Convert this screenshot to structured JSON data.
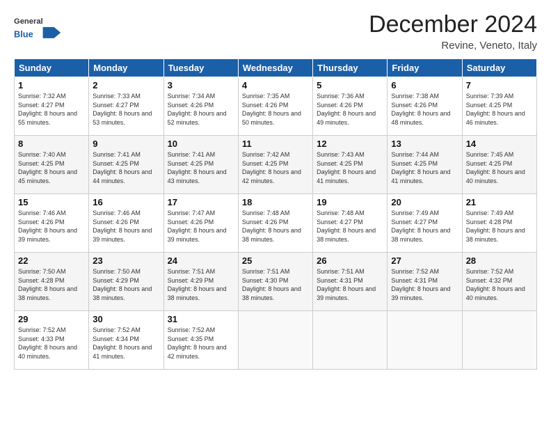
{
  "header": {
    "month": "December 2024",
    "location": "Revine, Veneto, Italy",
    "logo_general": "General",
    "logo_blue": "Blue"
  },
  "weekdays": [
    "Sunday",
    "Monday",
    "Tuesday",
    "Wednesday",
    "Thursday",
    "Friday",
    "Saturday"
  ],
  "weeks": [
    [
      {
        "day": 1,
        "sunrise": "7:32 AM",
        "sunset": "4:27 PM",
        "daylight": "8 hours and 55 minutes."
      },
      {
        "day": 2,
        "sunrise": "7:33 AM",
        "sunset": "4:27 PM",
        "daylight": "8 hours and 53 minutes."
      },
      {
        "day": 3,
        "sunrise": "7:34 AM",
        "sunset": "4:26 PM",
        "daylight": "8 hours and 52 minutes."
      },
      {
        "day": 4,
        "sunrise": "7:35 AM",
        "sunset": "4:26 PM",
        "daylight": "8 hours and 50 minutes."
      },
      {
        "day": 5,
        "sunrise": "7:36 AM",
        "sunset": "4:26 PM",
        "daylight": "8 hours and 49 minutes."
      },
      {
        "day": 6,
        "sunrise": "7:38 AM",
        "sunset": "4:26 PM",
        "daylight": "8 hours and 48 minutes."
      },
      {
        "day": 7,
        "sunrise": "7:39 AM",
        "sunset": "4:25 PM",
        "daylight": "8 hours and 46 minutes."
      }
    ],
    [
      {
        "day": 8,
        "sunrise": "7:40 AM",
        "sunset": "4:25 PM",
        "daylight": "8 hours and 45 minutes."
      },
      {
        "day": 9,
        "sunrise": "7:41 AM",
        "sunset": "4:25 PM",
        "daylight": "8 hours and 44 minutes."
      },
      {
        "day": 10,
        "sunrise": "7:41 AM",
        "sunset": "4:25 PM",
        "daylight": "8 hours and 43 minutes."
      },
      {
        "day": 11,
        "sunrise": "7:42 AM",
        "sunset": "4:25 PM",
        "daylight": "8 hours and 42 minutes."
      },
      {
        "day": 12,
        "sunrise": "7:43 AM",
        "sunset": "4:25 PM",
        "daylight": "8 hours and 41 minutes."
      },
      {
        "day": 13,
        "sunrise": "7:44 AM",
        "sunset": "4:25 PM",
        "daylight": "8 hours and 41 minutes."
      },
      {
        "day": 14,
        "sunrise": "7:45 AM",
        "sunset": "4:25 PM",
        "daylight": "8 hours and 40 minutes."
      }
    ],
    [
      {
        "day": 15,
        "sunrise": "7:46 AM",
        "sunset": "4:26 PM",
        "daylight": "8 hours and 39 minutes."
      },
      {
        "day": 16,
        "sunrise": "7:46 AM",
        "sunset": "4:26 PM",
        "daylight": "8 hours and 39 minutes."
      },
      {
        "day": 17,
        "sunrise": "7:47 AM",
        "sunset": "4:26 PM",
        "daylight": "8 hours and 39 minutes."
      },
      {
        "day": 18,
        "sunrise": "7:48 AM",
        "sunset": "4:26 PM",
        "daylight": "8 hours and 38 minutes."
      },
      {
        "day": 19,
        "sunrise": "7:48 AM",
        "sunset": "4:27 PM",
        "daylight": "8 hours and 38 minutes."
      },
      {
        "day": 20,
        "sunrise": "7:49 AM",
        "sunset": "4:27 PM",
        "daylight": "8 hours and 38 minutes."
      },
      {
        "day": 21,
        "sunrise": "7:49 AM",
        "sunset": "4:28 PM",
        "daylight": "8 hours and 38 minutes."
      }
    ],
    [
      {
        "day": 22,
        "sunrise": "7:50 AM",
        "sunset": "4:28 PM",
        "daylight": "8 hours and 38 minutes."
      },
      {
        "day": 23,
        "sunrise": "7:50 AM",
        "sunset": "4:29 PM",
        "daylight": "8 hours and 38 minutes."
      },
      {
        "day": 24,
        "sunrise": "7:51 AM",
        "sunset": "4:29 PM",
        "daylight": "8 hours and 38 minutes."
      },
      {
        "day": 25,
        "sunrise": "7:51 AM",
        "sunset": "4:30 PM",
        "daylight": "8 hours and 38 minutes."
      },
      {
        "day": 26,
        "sunrise": "7:51 AM",
        "sunset": "4:31 PM",
        "daylight": "8 hours and 39 minutes."
      },
      {
        "day": 27,
        "sunrise": "7:52 AM",
        "sunset": "4:31 PM",
        "daylight": "8 hours and 39 minutes."
      },
      {
        "day": 28,
        "sunrise": "7:52 AM",
        "sunset": "4:32 PM",
        "daylight": "8 hours and 40 minutes."
      }
    ],
    [
      {
        "day": 29,
        "sunrise": "7:52 AM",
        "sunset": "4:33 PM",
        "daylight": "8 hours and 40 minutes."
      },
      {
        "day": 30,
        "sunrise": "7:52 AM",
        "sunset": "4:34 PM",
        "daylight": "8 hours and 41 minutes."
      },
      {
        "day": 31,
        "sunrise": "7:52 AM",
        "sunset": "4:35 PM",
        "daylight": "8 hours and 42 minutes."
      },
      null,
      null,
      null,
      null
    ]
  ]
}
